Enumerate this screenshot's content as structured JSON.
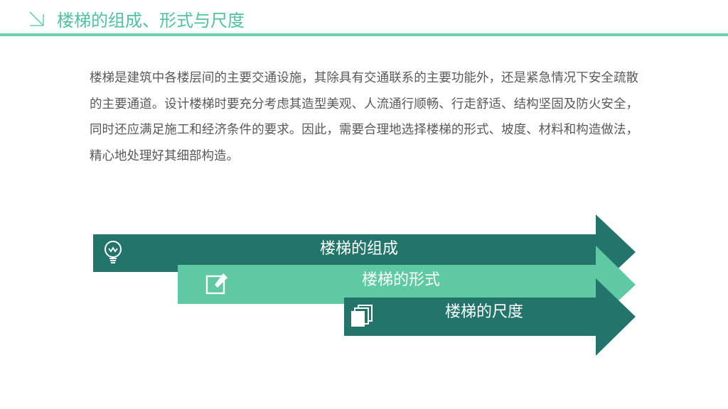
{
  "header": {
    "title": "楼梯的组成、形式与尺度"
  },
  "body": {
    "paragraph": "楼梯是建筑中各楼层间的主要交通设施，其除具有交通联系的主要功能外，还是紧急情况下安全疏散的主要通道。设计楼梯时要充分考虑其造型美观、人流通行顺畅、行走舒适、结构坚固及防火安全，同时还应满足施工和经济条件的要求。因此，需要合理地选择楼梯的形式、坡度、材料和构造做法，精心地处理好其细部构造。"
  },
  "arrows": [
    {
      "label": "楼梯的组成",
      "icon": "lightbulb-icon"
    },
    {
      "label": "楼梯的形式",
      "icon": "edit-icon"
    },
    {
      "label": "楼梯的尺度",
      "icon": "pages-icon"
    }
  ],
  "colors": {
    "dark_teal": "#23756b",
    "light_green": "#5ec9a3",
    "title_green": "#4fc39e",
    "rule_green": "#6fd0ae",
    "body_text": "#595959"
  }
}
